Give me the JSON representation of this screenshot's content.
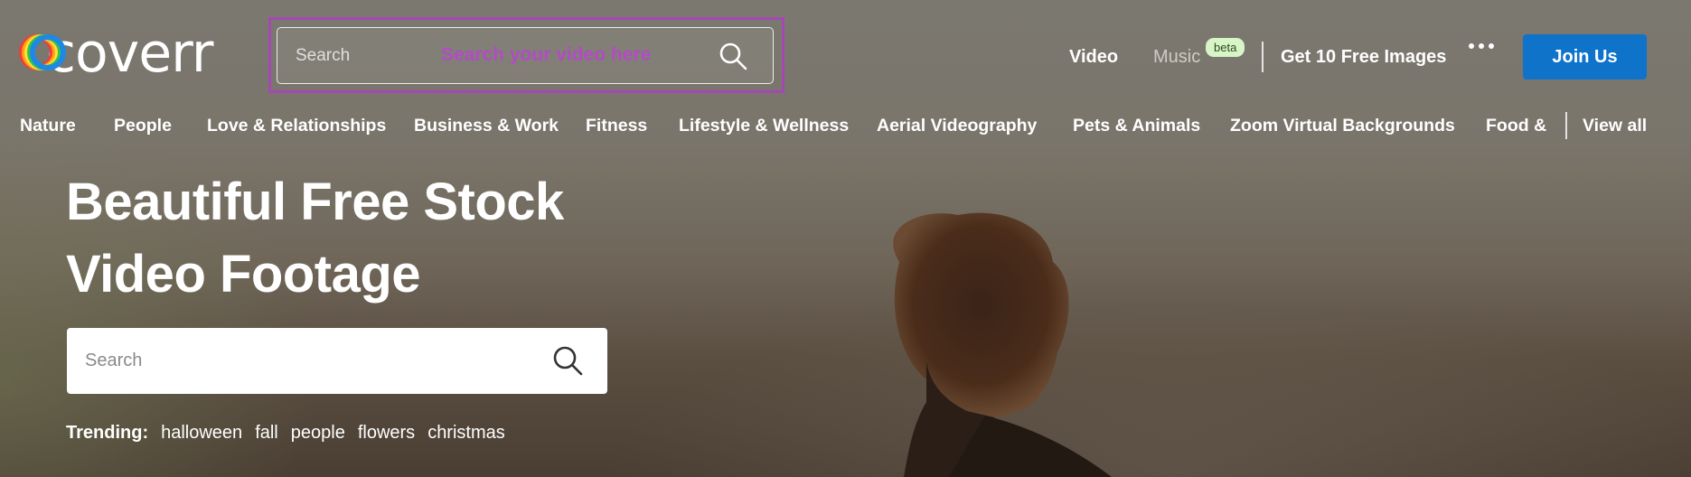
{
  "header": {
    "logo_text": "coverr",
    "logo_colors": [
      "#f23b3b",
      "#ff9f1a",
      "#ffe033",
      "#35c24a",
      "#1e88e5"
    ],
    "search": {
      "placeholder": "Search",
      "hint": "Search your video here"
    },
    "nav": {
      "video": "Video",
      "music": "Music",
      "music_badge": "beta",
      "free_images": "Get 10 Free Images",
      "more_icon": "more-dots-icon",
      "join": "Join Us"
    }
  },
  "categories": [
    "Nature",
    "People",
    "Love & Relationships",
    "Business & Work",
    "Fitness",
    "Lifestyle & Wellness",
    "Aerial Videography",
    "Pets & Animals",
    "Zoom Virtual Backgrounds",
    "Food &",
    "View all"
  ],
  "hero": {
    "title_line1": "Beautiful Free Stock",
    "title_line2": "Video Footage",
    "search_placeholder": "Search",
    "trending_label": "Trending:",
    "trending": [
      "halloween",
      "fall",
      "people",
      "flowers",
      "christmas"
    ]
  },
  "colors": {
    "accent": "#0f73c9",
    "highlight": "#a548b4",
    "beta_bg": "#d7f5c6"
  }
}
